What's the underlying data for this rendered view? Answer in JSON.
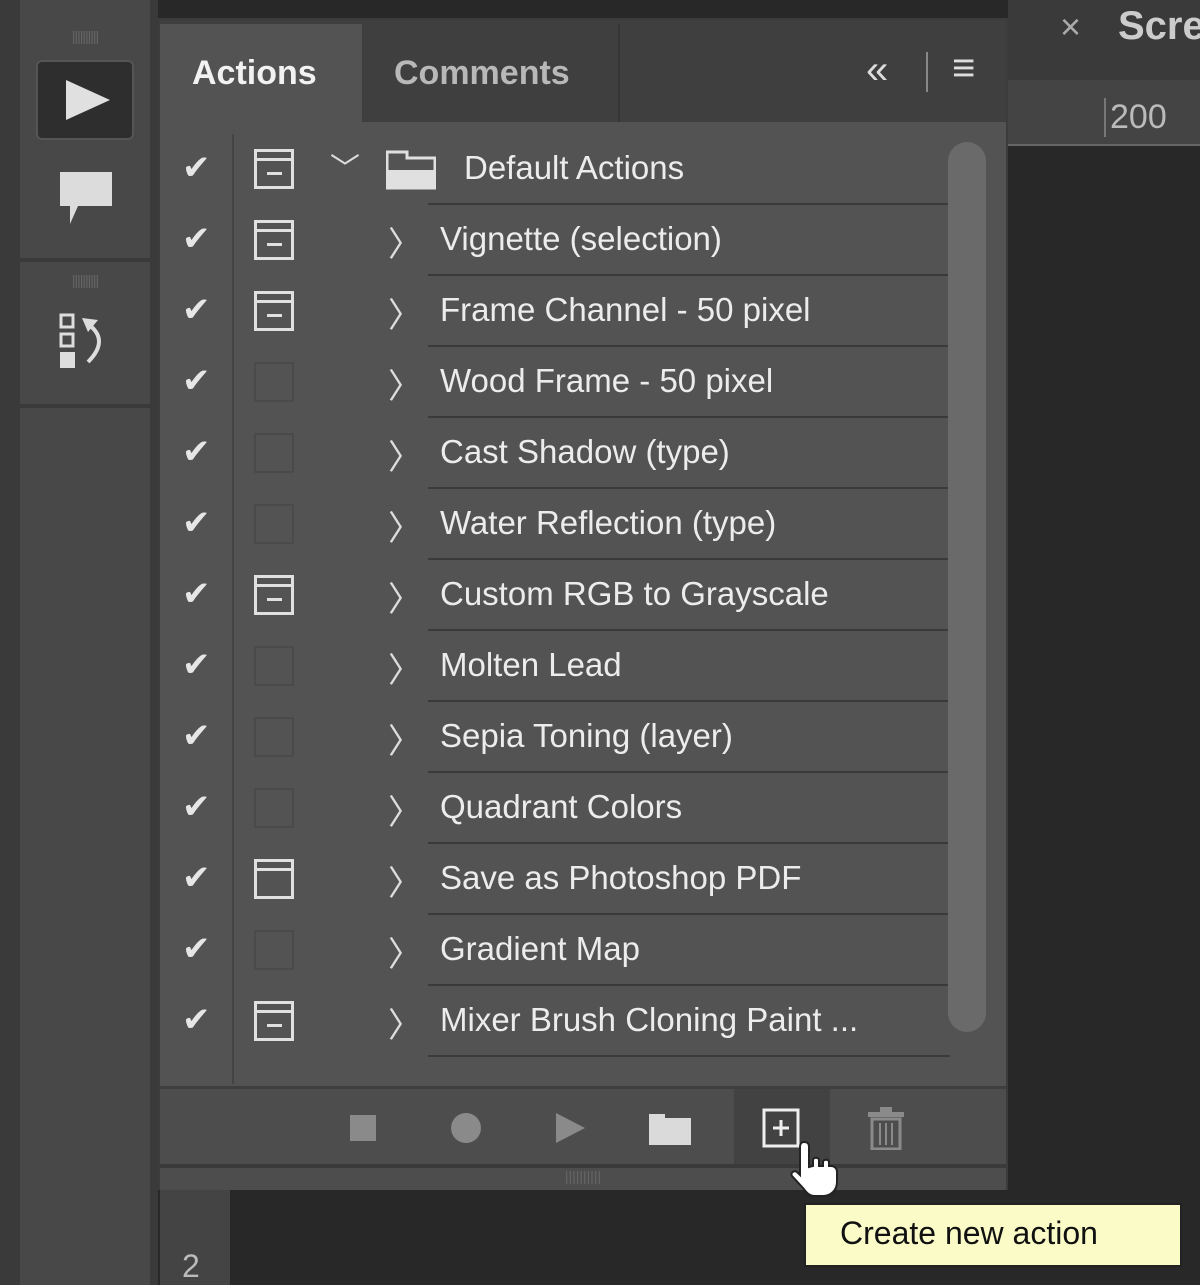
{
  "tabs": {
    "actions": "Actions",
    "comments": "Comments"
  },
  "header_icons": {
    "collapse": "«",
    "menu": "≡"
  },
  "doc_tab": {
    "close": "×",
    "title": "Scre"
  },
  "ruler": {
    "top": "200",
    "left": "2"
  },
  "set": {
    "label": "Default Actions",
    "checked": true,
    "dialog": true,
    "expanded": true
  },
  "actions": [
    {
      "label": "Vignette (selection)",
      "dialog": "on"
    },
    {
      "label": "Frame Channel - 50 pixel",
      "dialog": "on"
    },
    {
      "label": "Wood Frame - 50 pixel",
      "dialog": "off"
    },
    {
      "label": "Cast Shadow (type)",
      "dialog": "off"
    },
    {
      "label": "Water Reflection (type)",
      "dialog": "off"
    },
    {
      "label": "Custom RGB to Grayscale",
      "dialog": "on"
    },
    {
      "label": "Molten Lead",
      "dialog": "off"
    },
    {
      "label": "Sepia Toning (layer)",
      "dialog": "off"
    },
    {
      "label": "Quadrant Colors",
      "dialog": "off"
    },
    {
      "label": "Save as Photoshop PDF",
      "dialog": "partial"
    },
    {
      "label": "Gradient Map",
      "dialog": "off"
    },
    {
      "label": "Mixer Brush Cloning Paint ...",
      "dialog": "on"
    }
  ],
  "tooltip": "Create new action"
}
